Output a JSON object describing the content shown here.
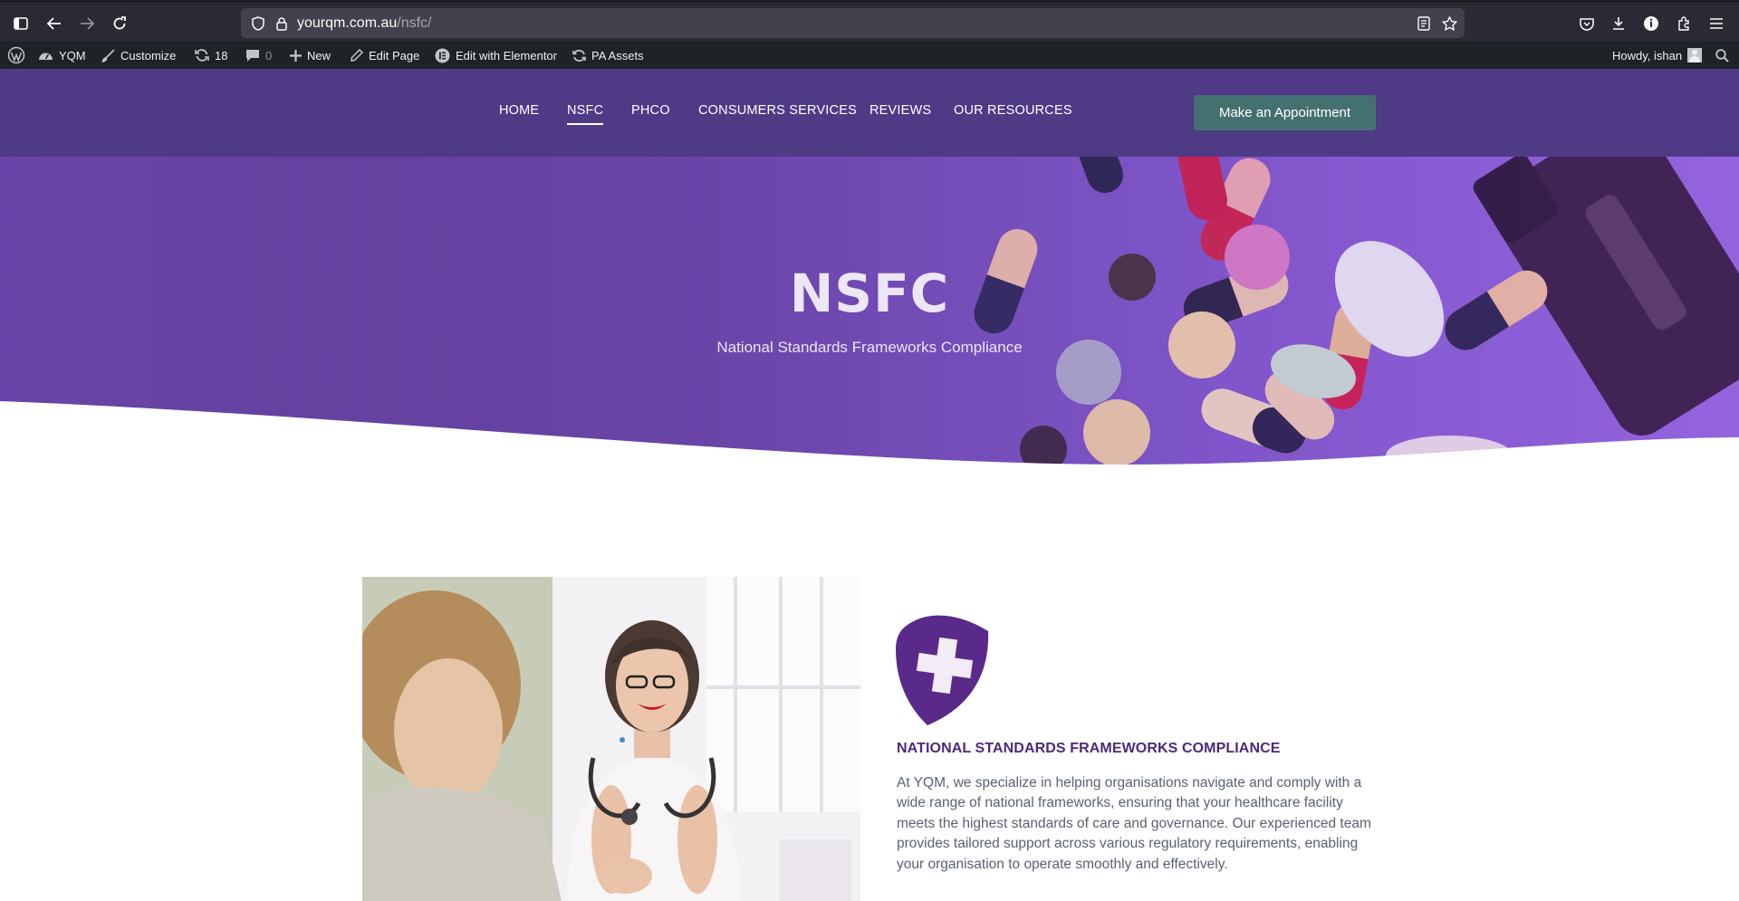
{
  "browser": {
    "url_host": "yourqm.com.au",
    "url_path": "/nsfc/"
  },
  "admin_bar": {
    "site_name": "YQM",
    "customize": "Customize",
    "updates_count": "18",
    "comments_count": "0",
    "new_label": "New",
    "edit_page": "Edit Page",
    "edit_elementor": "Edit with Elementor",
    "pa_assets": "PA Assets",
    "howdy": "Howdy, ishan"
  },
  "nav": {
    "items": [
      {
        "label": "HOME"
      },
      {
        "label": "NSFC"
      },
      {
        "label": "PHCO"
      },
      {
        "label": "CONSUMERS SERVICES"
      },
      {
        "label": "REVIEWS"
      },
      {
        "label": "OUR RESOURCES"
      }
    ],
    "active": "NSFC",
    "cta_label": "Make an Appointment"
  },
  "hero": {
    "title": "NSFC",
    "subtitle": "National Standards Frameworks Compliance"
  },
  "section": {
    "heading": "NATIONAL STANDARDS FRAMEWORKS COMPLIANCE",
    "body": "At YQM, we specialize in helping organisations navigate and comply with a wide range of national frameworks, ensuring that your healthcare facility meets the highest standards of care and governance. Our experienced team provides tailored support across various regulatory requirements, enabling your organisation to operate smoothly and effectively."
  },
  "colors": {
    "header_bg": "#4f3a86",
    "cta_bg": "#457072",
    "heading": "#4b2a7c",
    "shield": "#5a2a8a"
  }
}
